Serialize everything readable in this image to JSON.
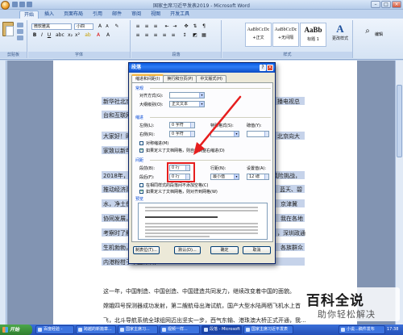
{
  "window": {
    "title": "国家主席习近平发表2019 - Microsoft Word",
    "min": "–",
    "max": "□",
    "close": "×"
  },
  "ribbon": {
    "tabs": [
      "开始",
      "插入",
      "页面布局",
      "引用",
      "邮件",
      "审阅",
      "视图",
      "开发工具"
    ],
    "font_name": "微软雅黑",
    "font_size": "小四",
    "groups": [
      "剪贴板",
      "字体",
      "段落",
      "样式"
    ],
    "styles": [
      {
        "sample": "AaBbCcDc",
        "name": "+正文"
      },
      {
        "sample": "AaBbCcDc",
        "name": "+无间隔"
      },
      {
        "sample": "AaBb",
        "name": "标题 1"
      }
    ],
    "change_styles": "更改样式",
    "editing": "编辑"
  },
  "document": {
    "lines": [
      "新华社北京12月31日电 国家主席习近平通过中央广播电视总",
      "台和互联网，",
      "大家好！时间过得真快，2019年就要过去了。我在北京向大",
      "家致以新年的美好祝福！",
      "2018年，我们克服各种困难和风险挑战，",
      "推动经济高质量发展，",
      "水，净土保卫战持续推进，",
      "协同发展，",
      "考察时了解到，",
      "生机勃勃，",
      "内港粉柑子平田深圳，",
      "这一年，中国制造、中国创造、中国建造共同发力，继续改变着中国的面貌。",
      "嫦娥四号探测器成功发射，第二艘航母出海试航，国产大型水陆两栖飞机水上首",
      "飞，北斗导航系统全球组网迈出坚实一步，西气东输、港珠澳大桥正式开通，我..."
    ],
    "right_fragments": [
      "播电视总",
      "北京向大",
      "风险挑战，",
      "、蓝天、碧",
      "京津冀",
      "我在各地",
      "，深圳政通",
      "各族群众"
    ]
  },
  "dialog": {
    "title": "段落",
    "help": "?",
    "close": "×",
    "tabs": [
      "缩进和间距(I)",
      "换行和分页(P)",
      "中文版式(H)"
    ],
    "general": {
      "section": "常规",
      "alignment_label": "对齐方式(G):",
      "alignment_value": "",
      "outline_label": "大纲级别(O):",
      "outline_value": "正文文本"
    },
    "indent": {
      "section": "缩进",
      "left_label": "左侧(L):",
      "left_value": "0 字符",
      "right_label": "右侧(R):",
      "right_value": "0 字符",
      "special_label": "特殊格式(S):",
      "special_value": "",
      "measure_label": "磅值(Y):",
      "measure_value": "",
      "mirror_label": "对称缩进(M)",
      "auto_adjust_label": "如果定义了文档网格，则自动调整右缩进(D)"
    },
    "spacing": {
      "section": "间距",
      "before_label": "段前(B):",
      "before_value": "0 行",
      "after_label": "段后(F):",
      "after_value": "0 行",
      "line_spacing_label": "行距(N):",
      "line_spacing_value": "最小值",
      "at_label": "设置值(A):",
      "at_value": "12 磅",
      "no_space_label": "在相同样式的段落间不添加空格(C)",
      "snap_grid_label": "如果定义了文档网格，则对齐到网格(W)"
    },
    "preview": {
      "section": "预览"
    },
    "buttons": {
      "tabs": "制表位(T)...",
      "default": "默认(D)...",
      "ok": "确定",
      "cancel": "取消"
    }
  },
  "taskbar": {
    "start": "开始",
    "tasks": [
      "百度经验 -",
      "跨越的新篇章...",
      "国家主席习...",
      "视频一样...",
      "段落 - Microsoft",
      "国家主席习近平发表",
      "小说...稿件发布"
    ],
    "clock": "17:38"
  },
  "watermark": {
    "main": "百科全说",
    "sub": "助你轻松解决"
  }
}
